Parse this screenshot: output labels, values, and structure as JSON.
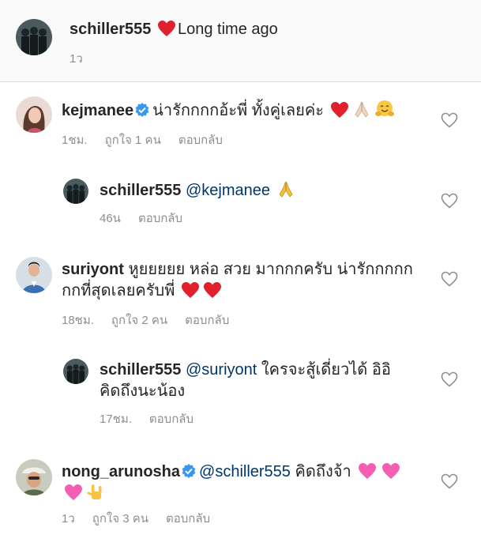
{
  "caption": {
    "username": "schiller555",
    "text": "Long time ago",
    "time": "1ว"
  },
  "comments": [
    {
      "username": "kejmanee",
      "verified": true,
      "text": "น่ารักกกกอ้ะพี่ ทั้งคู่เลยค่ะ",
      "time": "1ชม.",
      "likes": "ถูกใจ 1 คน",
      "reply": "ตอบกลับ"
    },
    {
      "username": "schiller555",
      "mention": "@kejmanee",
      "time": "46น",
      "reply": "ตอบกลับ"
    },
    {
      "username": "suriyont",
      "text_line1": "หูยยยยย หล่อ สวย มากกกครับ น่ารักกกกก",
      "text_line2": "กกที่สุดเลยครับพี่",
      "time": "18ชม.",
      "likes": "ถูกใจ 2 คน",
      "reply": "ตอบกลับ"
    },
    {
      "username": "schiller555",
      "mention": "@suriyont",
      "text_line1": "ใครจะสู้เดี่ยวได้ อิอิ",
      "text_line2": "คิดถึงนะน้อง",
      "time": "17ชม.",
      "reply": "ตอบกลับ"
    },
    {
      "username": "nong_arunosha",
      "verified": true,
      "mention": "@schiller555",
      "text": "คิดถึงจ้า",
      "time": "1ว",
      "likes": "ถูกใจ 3 คน",
      "reply": "ตอบกลับ"
    }
  ],
  "colors": {
    "heart": "#ed4956",
    "verified": "#3897f0",
    "mention": "#00376b",
    "meta": "#8e8e8e"
  }
}
